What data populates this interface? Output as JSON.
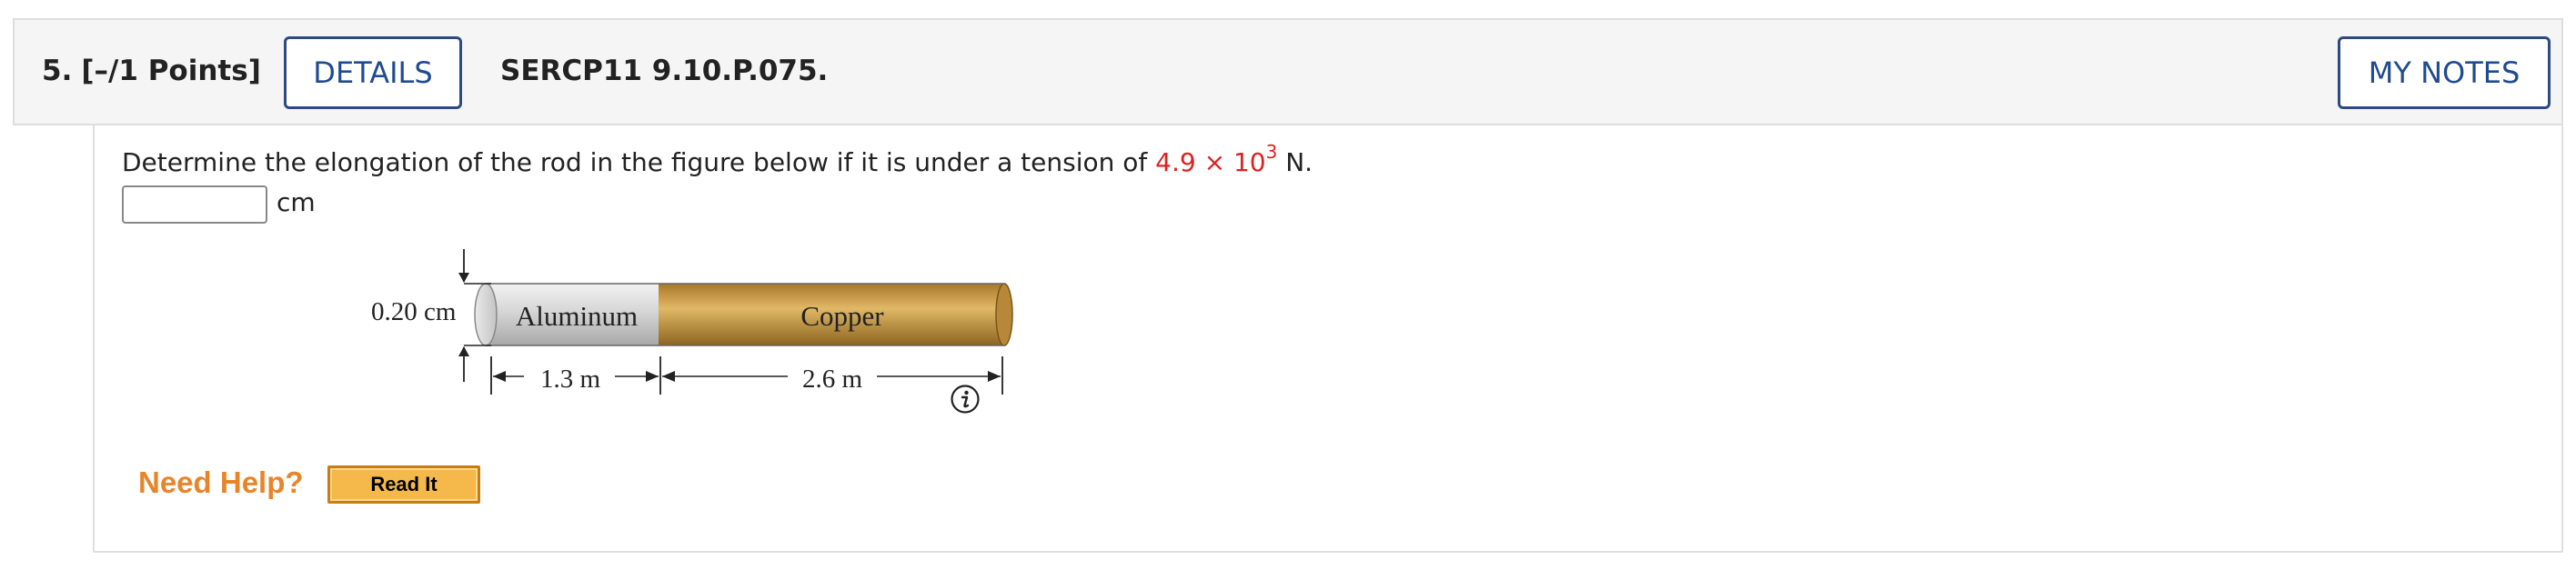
{
  "header": {
    "question_number": "5.",
    "points": "[–/1 Points]",
    "details_label": "DETAILS",
    "problem_code": "SERCP11 9.10.P.075.",
    "my_notes_label": "MY NOTES"
  },
  "question": {
    "prompt_before": "Determine the elongation of the rod in the figure below if it is under a tension of ",
    "value_mantissa": "4.9 × 10",
    "value_exponent": "3",
    "prompt_after": " N.",
    "answer_value": "",
    "answer_unit": "cm",
    "value_color": "#dd2222"
  },
  "figure": {
    "diameter_label": "0.20 cm",
    "aluminum_label": "Aluminum",
    "copper_label": "Copper",
    "aluminum_length": "1.3 m",
    "copper_length": "2.6 m",
    "aluminum_color": "#d8d8d8",
    "copper_color": "#c89a42"
  },
  "help": {
    "need_help_label": "Need Help?",
    "read_it_label": "Read It"
  }
}
